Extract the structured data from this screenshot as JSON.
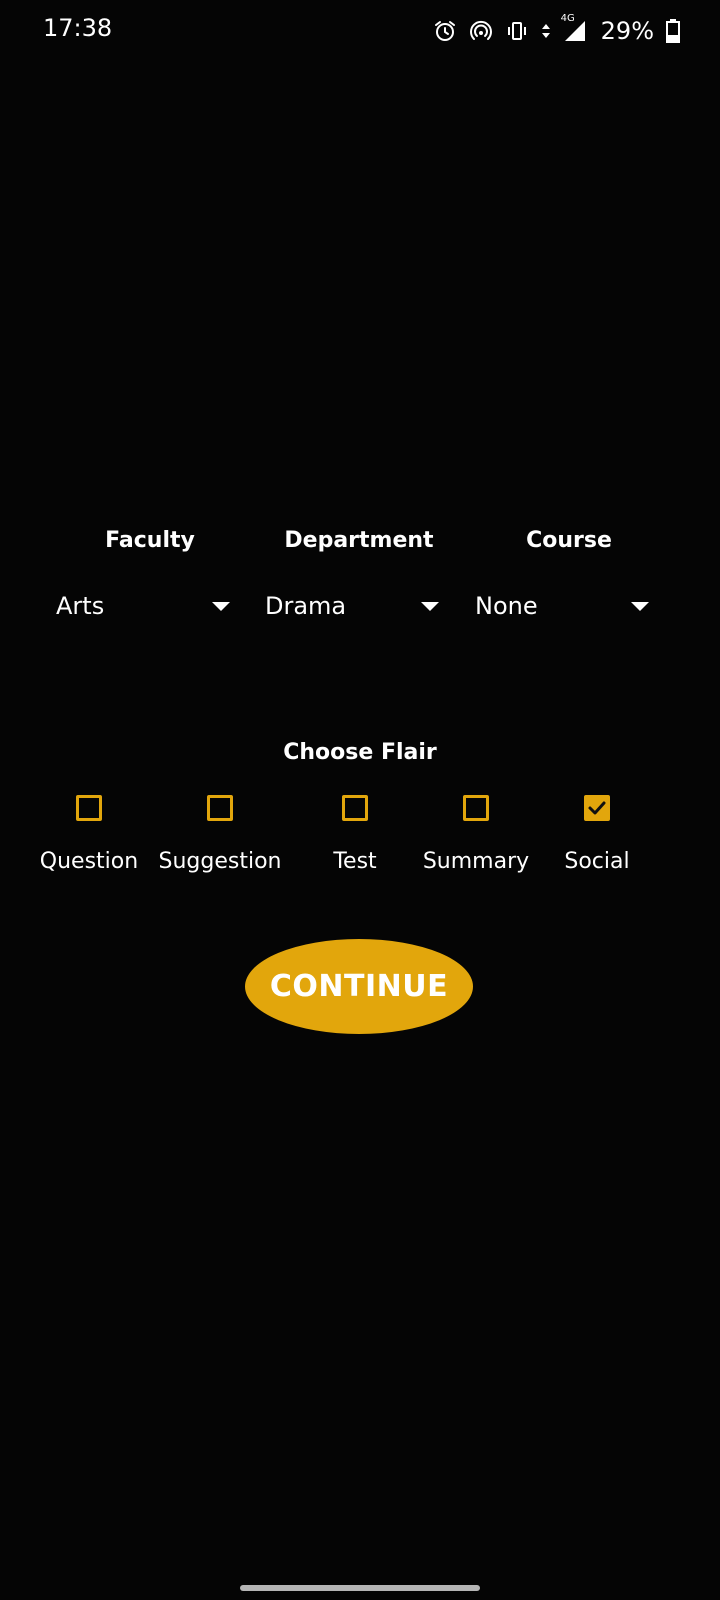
{
  "status_bar": {
    "time": "17:38",
    "network": "4G",
    "battery": "29%",
    "icons": [
      "alarm-icon",
      "hotspot-icon",
      "vibrate-icon",
      "data-arrows-icon",
      "signal-icon",
      "battery-icon"
    ]
  },
  "selectors": [
    {
      "label": "Faculty",
      "value": "Arts"
    },
    {
      "label": "Department",
      "value": "Drama"
    },
    {
      "label": "Course",
      "value": "None"
    }
  ],
  "flair": {
    "title": "Choose Flair",
    "options": [
      {
        "label": "Question",
        "checked": false
      },
      {
        "label": "Suggestion",
        "checked": false
      },
      {
        "label": "Test",
        "checked": false
      },
      {
        "label": "Summary",
        "checked": false
      },
      {
        "label": "Social",
        "checked": true
      }
    ]
  },
  "continue_label": "CONTINUE",
  "colors": {
    "background": "#050505",
    "accent": "#e2a60c",
    "text": "#ffffff"
  }
}
